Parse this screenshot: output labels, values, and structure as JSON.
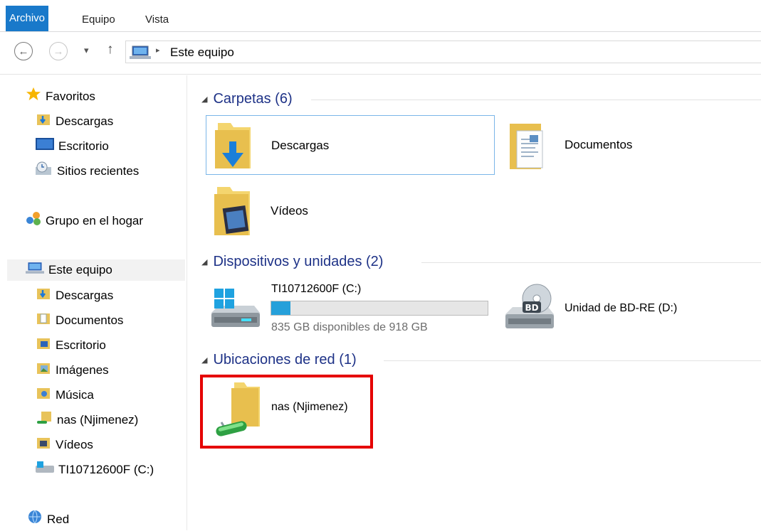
{
  "ribbon": {
    "tabs": [
      {
        "label": "Archivo"
      },
      {
        "label": "Equipo"
      },
      {
        "label": "Vista"
      }
    ]
  },
  "address_bar": {
    "back": "←",
    "forward": "→",
    "recent": "▾",
    "up": "↑",
    "separator": "▸",
    "crumb": "Este equipo"
  },
  "sidebar": {
    "favorites": {
      "label": "Favoritos",
      "items": [
        {
          "label": "Descargas"
        },
        {
          "label": "Escritorio"
        },
        {
          "label": "Sitios recientes"
        }
      ]
    },
    "homegroup": {
      "label": "Grupo en el hogar"
    },
    "this_pc": {
      "label": "Este equipo",
      "items": [
        {
          "label": "Descargas"
        },
        {
          "label": "Documentos"
        },
        {
          "label": "Escritorio"
        },
        {
          "label": "Imágenes"
        },
        {
          "label": "Música"
        },
        {
          "label": "nas (Njimenez)"
        },
        {
          "label": "Vídeos"
        },
        {
          "label": "TI10712600F (C:)"
        }
      ]
    },
    "network": {
      "label": "Red"
    }
  },
  "content": {
    "folders": {
      "header": "Carpetas (6)",
      "items": [
        {
          "label": "Descargas"
        },
        {
          "label": "Documentos"
        },
        {
          "label": "Vídeos"
        }
      ]
    },
    "devices": {
      "header": "Dispositivos y unidades (2)",
      "drive_c": {
        "label": "TI10712600F (C:)",
        "free_text": "835 GB disponibles de 918 GB",
        "used_fraction": 0.09
      },
      "drive_d": {
        "label": "Unidad de BD-RE (D:)",
        "disc_badge": "BD"
      }
    },
    "network_locations": {
      "header": "Ubicaciones de red (1)",
      "items": [
        {
          "label": "nas (Njimenez)"
        }
      ]
    }
  },
  "colors": {
    "accent": "#1979ca",
    "header_text": "#1e3287",
    "highlight": "#e50000",
    "progress": "#26a0da"
  }
}
